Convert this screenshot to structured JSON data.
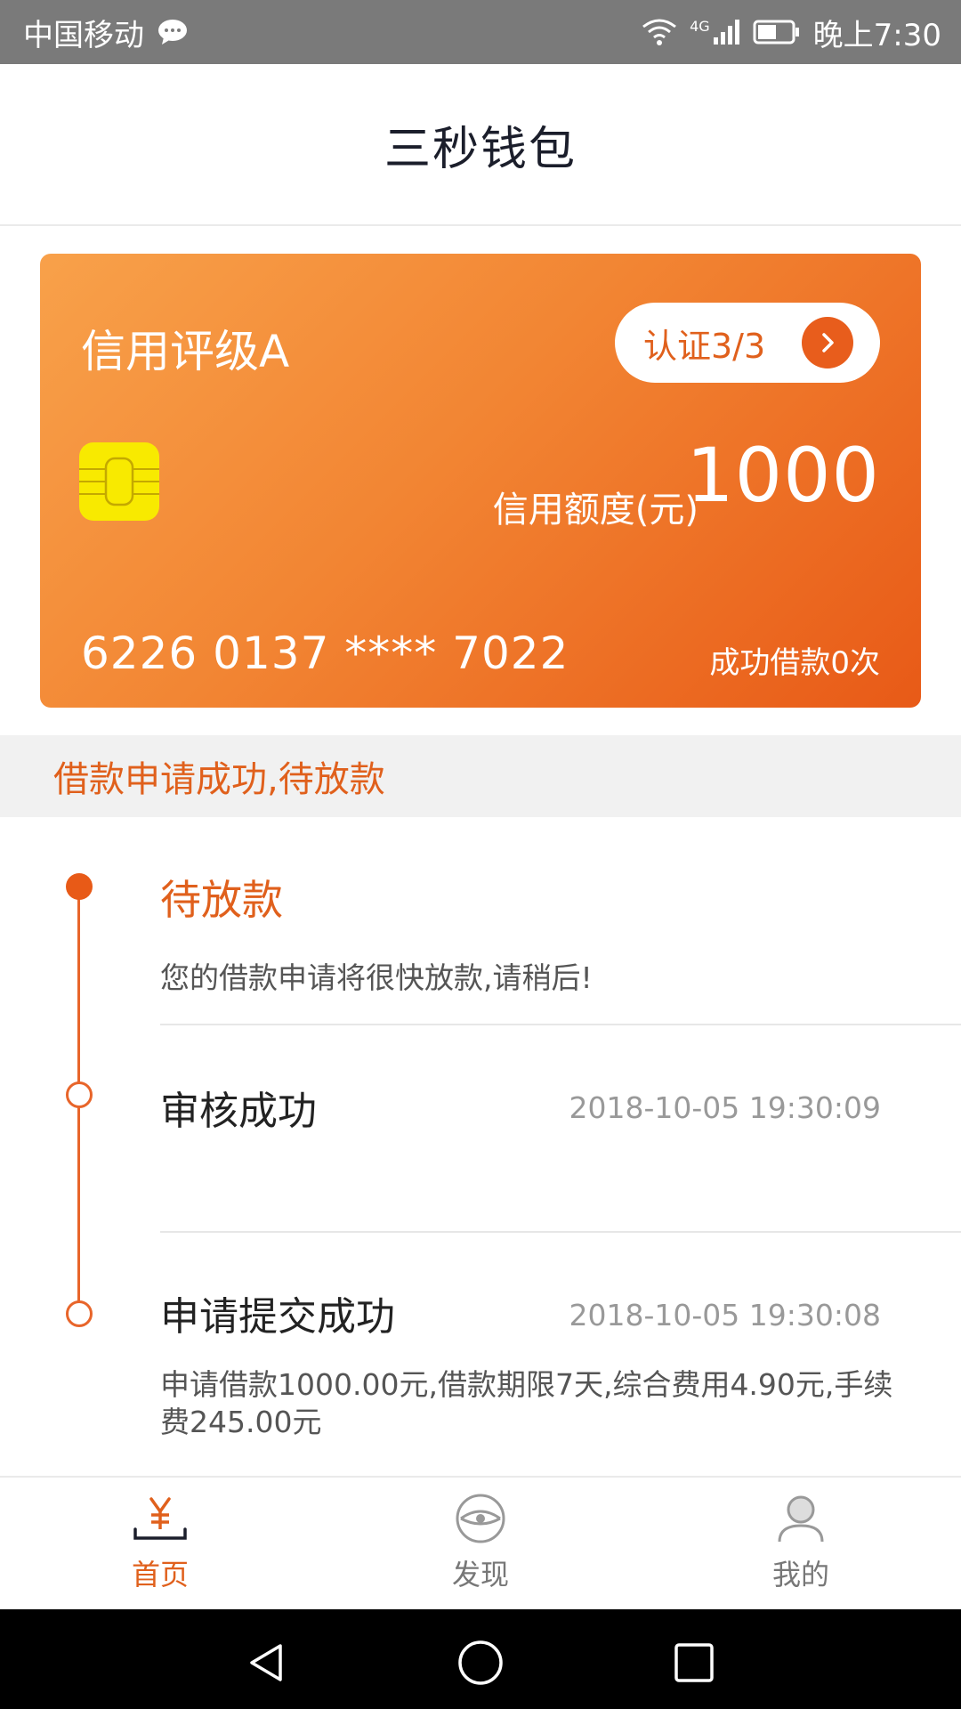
{
  "status_bar": {
    "carrier": "中国移动",
    "network": "4G",
    "time": "晚上7:30"
  },
  "header": {
    "title": "三秒钱包"
  },
  "card": {
    "rating": "信用评级A",
    "verify_label": "认证3/3",
    "limit_label": "信用额度(元)",
    "limit_value": "1000",
    "card_number": "6226 0137 **** 7022",
    "loan_count": "成功借款0次"
  },
  "banner": {
    "text": "借款申请成功,待放款"
  },
  "timeline": {
    "steps": [
      {
        "title": "待放款",
        "description": "您的借款申请将很快放款,请稍后!",
        "time": ""
      },
      {
        "title": "审核成功",
        "description": "",
        "time": "2018-10-05 19:30:09"
      },
      {
        "title": "申请提交成功",
        "description": "申请借款1000.00元,借款期限7天,综合费用4.90元,手续费245.00元",
        "time": "2018-10-05 19:30:08"
      }
    ]
  },
  "tabs": [
    {
      "label": "首页",
      "icon": "yuan-wallet-icon",
      "active": true
    },
    {
      "label": "发现",
      "icon": "eye-icon",
      "active": false
    },
    {
      "label": "我的",
      "icon": "user-icon",
      "active": false
    }
  ],
  "colors": {
    "accent": "#e85a17",
    "card_gradient_start": "#f8a14a",
    "card_gradient_end": "#e85a17"
  }
}
